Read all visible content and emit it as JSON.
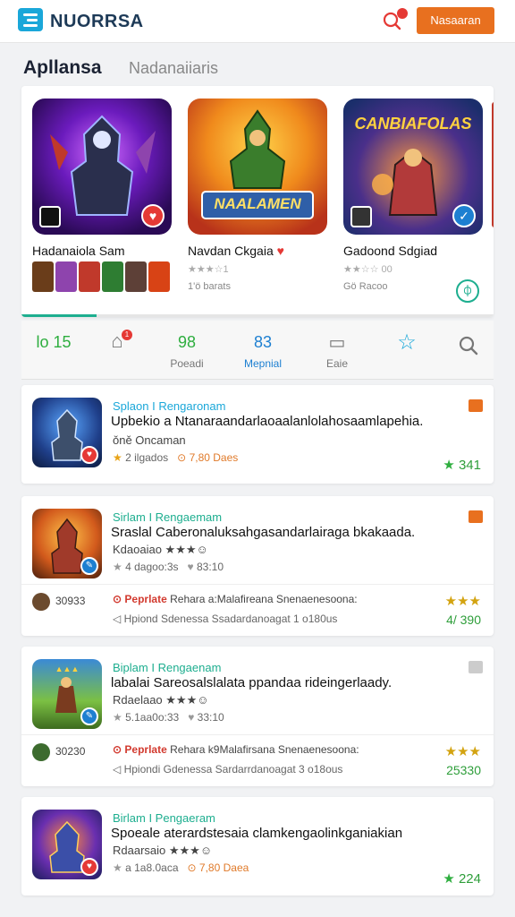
{
  "app": {
    "brand": "NUORRSA",
    "cta_label": "Nasaaran",
    "colors": {
      "accent": "#e8701f",
      "brand": "#1aa7d9",
      "teal": "#1dae8f",
      "red": "#e53935"
    }
  },
  "section": {
    "title": "Apllansa",
    "subtitle": "Nadanaiiaris"
  },
  "featured": {
    "progress": 0.16,
    "cards": [
      {
        "title": "Hadanaiola Sam",
        "stars_text": "",
        "meta": "",
        "banner": "",
        "badge_icon": "heart-icon"
      },
      {
        "title": "Navdan Ckgaia",
        "stars_text": "★★★☆1",
        "meta": "1'ö barats",
        "banner": "NAALAMEN",
        "badge_icon": ""
      },
      {
        "title": "Gadoond Sdgiad",
        "stars_text": "★★☆☆ 00",
        "meta": "Gö Racoo",
        "banner": "CANBIAFOLAS",
        "badge_icon": "check-icon"
      }
    ]
  },
  "tabs": [
    {
      "icon_text": "lo 15",
      "label": "",
      "icon": "chart-icon",
      "color": "#2eae3f"
    },
    {
      "icon_text": "⌂",
      "label": "",
      "icon": "home-icon",
      "color": "#777",
      "badge": "1"
    },
    {
      "icon_text": "98",
      "label": "Poeadi",
      "icon": "number-icon",
      "color": "#2eae3f"
    },
    {
      "icon_text": "83",
      "label": "Mepnial",
      "icon": "number-icon",
      "color": "#1d7fd1"
    },
    {
      "icon_text": "▭",
      "label": "Eaie",
      "icon": "card-icon",
      "color": "#777"
    },
    {
      "icon_text": "☆",
      "label": "",
      "icon": "star-icon",
      "color": "#1aa7d9"
    },
    {
      "icon_text": "○",
      "label": "",
      "icon": "search-icon",
      "color": "#777"
    }
  ],
  "list": [
    {
      "category": "Splaon I Rengaronam",
      "category_color": "#1aa7d9",
      "title": "Upbekio a Ntanaraandarlaoaalanlolahosaamlapehia.",
      "subtitle": "ǒně Oncaman",
      "stats_left": "2 ilgados",
      "stats_right": "7,80 Daes",
      "score": "341",
      "flag_color": "#e8701f"
    },
    {
      "category": "Sirlam I Rengaemam",
      "category_color": "#1dae8f",
      "title": "Sraslal Caberonaluksahgasandarlairaga bkakaada.",
      "subtitle": "Kdaoaiao ★★★☺",
      "stats_left": "4 dagoo:3s",
      "stats_right": "83:10",
      "review_id": "30933",
      "review_tag": "Peprlate",
      "review_text": "Rehara a:Malafireana Snenaenesoona:",
      "review_sub": "Hpiond Sdenessa Ssadardanoagat 1 o180us",
      "ystars": "★★★",
      "gscore": "4/ 390",
      "flag_color": "#e8701f"
    },
    {
      "category": "Biplam I Rengaenam",
      "category_color": "#1dae8f",
      "title": "labalai Sareosalslalata ppandaa rideingerlaady.",
      "subtitle": "Rdaelaao ★★★☺",
      "stats_left": "5.1aa0o:33",
      "stats_right": "33:10",
      "review_id": "30230",
      "review_tag": "Peprlate",
      "review_text": "Rehara k9Malafirsana Snenaenesoona:",
      "review_sub": "Hpiondi Gdenessa Sardarrdanoagat 3 o18ous",
      "ystars": "★★★",
      "gscore": "25330",
      "flag_color": "#cccccc"
    },
    {
      "category": "Birlam I Pengaeram",
      "category_color": "#1dae8f",
      "title": "Spoeale aterardstesaia clamkengaolinkganiakian",
      "subtitle": "Rdaarsaio ★★★☺",
      "stats_left": "a 1a8.0aca",
      "stats_right": "7,80 Daea",
      "score": "224"
    }
  ]
}
